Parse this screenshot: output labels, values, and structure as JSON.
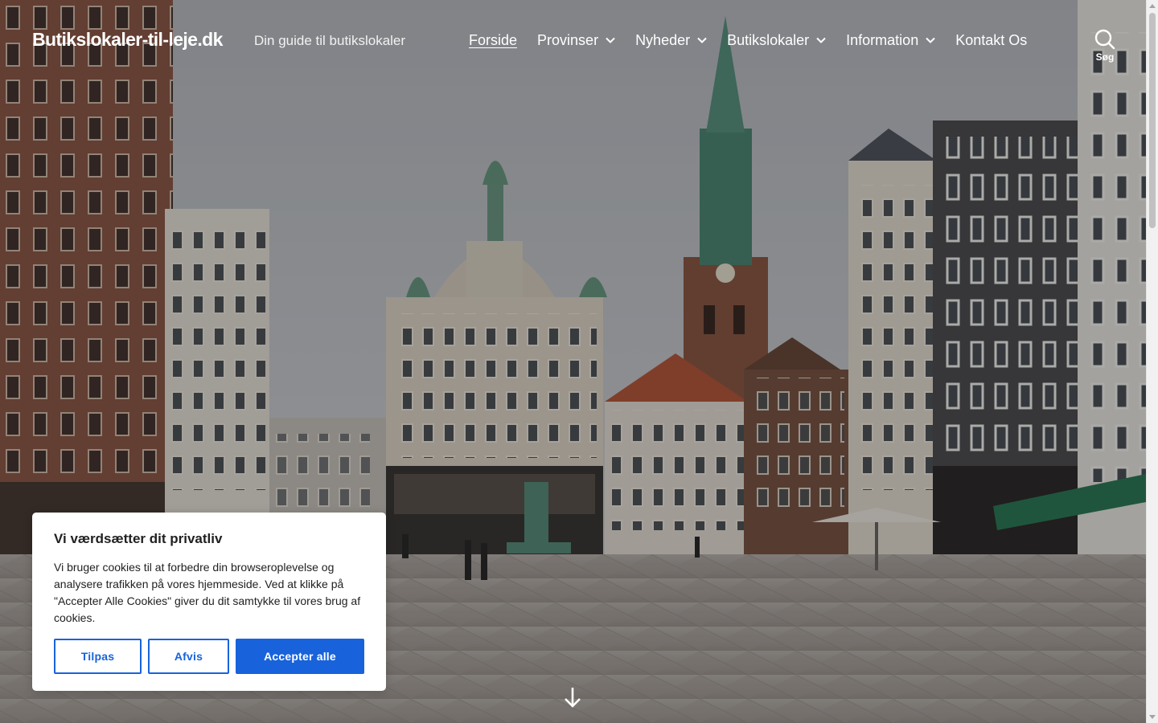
{
  "header": {
    "site_title": "Butikslokaler-til-leje.dk",
    "site_description": "Din guide til butikslokaler"
  },
  "nav": {
    "items": [
      {
        "label": "Forside",
        "current": true,
        "has_submenu": false
      },
      {
        "label": "Provinser",
        "current": false,
        "has_submenu": true
      },
      {
        "label": "Nyheder",
        "current": false,
        "has_submenu": true
      },
      {
        "label": "Butikslokaler",
        "current": false,
        "has_submenu": true
      },
      {
        "label": "Information",
        "current": false,
        "has_submenu": true
      },
      {
        "label": "Kontakt Os",
        "current": false,
        "has_submenu": false
      }
    ],
    "search_label": "Søg",
    "search_icon": "search-icon"
  },
  "hero": {
    "scroll_icon": "arrow-down-icon"
  },
  "cookie": {
    "title": "Vi værdsætter dit privatliv",
    "text": "Vi bruger cookies til at forbedre din browseroplevelse og analysere trafikken på vores hjemmeside. Ved at klikke på \"Accepter Alle Cookies\" giver du dit samtykke til vores brug af cookies.",
    "customize_label": "Tilpas",
    "reject_label": "Afvis",
    "accept_label": "Accepter alle"
  },
  "colors": {
    "accent": "#1863dc",
    "header_text": "#ffffff",
    "overlay": "#000000",
    "cookie_text": "#212121"
  }
}
